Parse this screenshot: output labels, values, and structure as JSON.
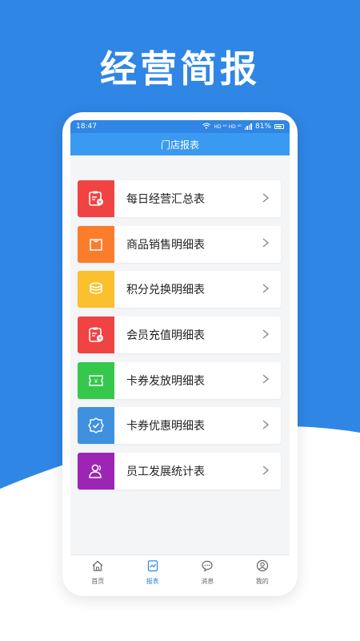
{
  "headline": "经营简报",
  "status": {
    "time": "18:47",
    "network": "HD ⁴ᴳ HD ⁴ᴳ",
    "battery": "81%"
  },
  "page_title": "门店报表",
  "colors": {
    "brand_blue": "#2f86e4"
  },
  "items": [
    {
      "label": "每日经营汇总表",
      "icon": "report-sheet-icon",
      "color": "#f04343"
    },
    {
      "label": "商品销售明细表",
      "icon": "shopping-bag-icon",
      "color": "#fb7d2c"
    },
    {
      "label": "积分兑换明细表",
      "icon": "coins-stack-icon",
      "color": "#fbc02d"
    },
    {
      "label": "会员充值明细表",
      "icon": "recharge-sheet-icon",
      "color": "#f04343"
    },
    {
      "label": "卡券发放明细表",
      "icon": "coupon-ticket-icon",
      "color": "#35c84d"
    },
    {
      "label": "卡券优惠明细表",
      "icon": "check-badge-icon",
      "color": "#3f91df"
    },
    {
      "label": "员工发展统计表",
      "icon": "staff-user-icon",
      "color": "#9c25b3"
    }
  ],
  "tabs": [
    {
      "label": "首页",
      "icon": "home-icon",
      "active": false
    },
    {
      "label": "报表",
      "icon": "report-icon",
      "active": true
    },
    {
      "label": "消息",
      "icon": "message-icon",
      "active": false
    },
    {
      "label": "我的",
      "icon": "profile-icon",
      "active": false
    }
  ]
}
